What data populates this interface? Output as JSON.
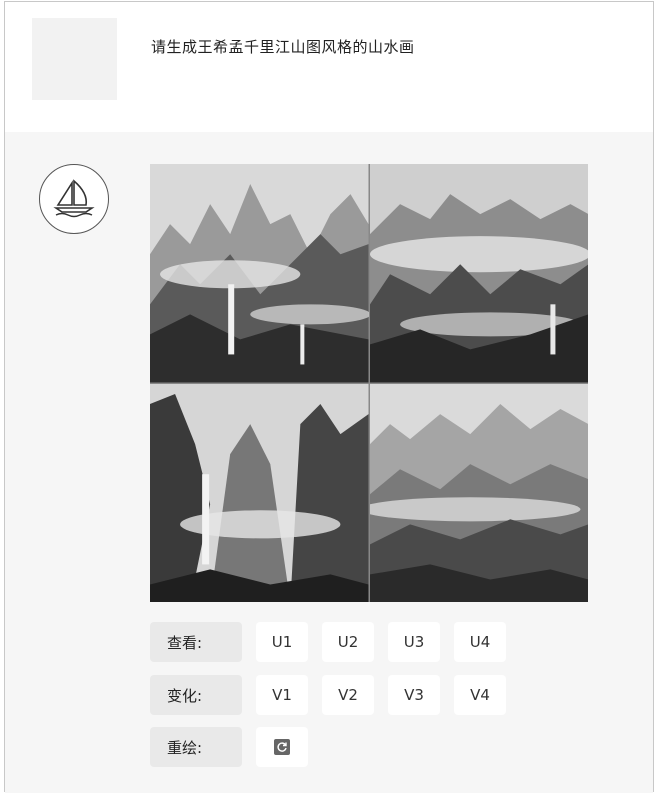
{
  "user": {
    "prompt": "请生成王希孟千里江山图风格的山水画"
  },
  "bot": {
    "avatar_icon": "sailboat-icon",
    "images": [
      "tile-1",
      "tile-2",
      "tile-3",
      "tile-4"
    ],
    "actions": {
      "view_label": "查看:",
      "upscale": [
        "U1",
        "U2",
        "U3",
        "U4"
      ],
      "variation_label": "变化:",
      "variations": [
        "V1",
        "V2",
        "V3",
        "V4"
      ],
      "redraw_label": "重绘:",
      "redraw_icon": "refresh-icon"
    }
  }
}
